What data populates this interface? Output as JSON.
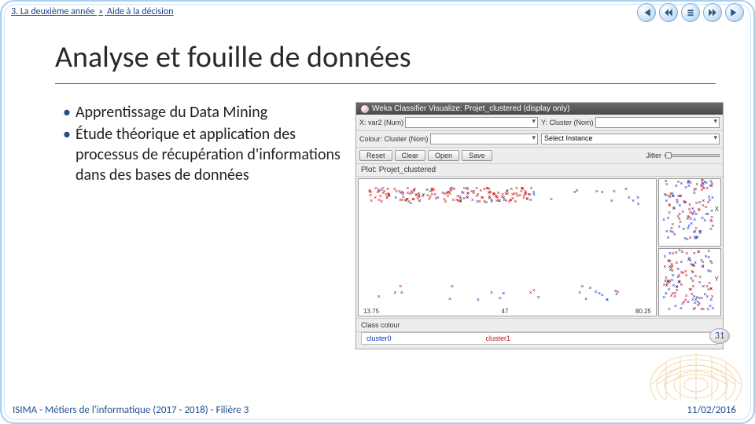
{
  "breadcrumb": {
    "part1": "3. La deuxième année",
    "sep": "»",
    "part2": "Aide à la décision"
  },
  "title": "Analyse et fouille de données",
  "bullets": {
    "b1": "Apprentissage du Data Mining",
    "b2": "Étude théorique et application des processus de récupération d'informations dans des bases de données"
  },
  "weka": {
    "window_title": "Weka Classifier Visualize: Projet_clustered (display only)",
    "x_label": "X: var2 (Num)",
    "y_label": "Y: Cluster (Nom)",
    "colour_label": "Colour: Cluster (Nom)",
    "select_label": "Select Instance",
    "btn_reset": "Reset",
    "btn_clear": "Clear",
    "btn_open": "Open",
    "btn_save": "Save",
    "jitter_label": "Jitter",
    "plot_title": "Plot: Projet_clustered",
    "x_ticks": [
      "13.75",
      "47",
      "80.25"
    ],
    "mini_x": "X",
    "mini_y": "Y",
    "legend_title": "Class colour",
    "legend_c0": "cluster0",
    "legend_c1": "cluster1"
  },
  "page_number": "31",
  "footer_left": "ISIMA - Métiers de l'informatique (2017 - 2018) - Filière 3",
  "footer_right": "11/02/2016",
  "colors": {
    "blue": "#1030c0",
    "red": "#c01010"
  }
}
